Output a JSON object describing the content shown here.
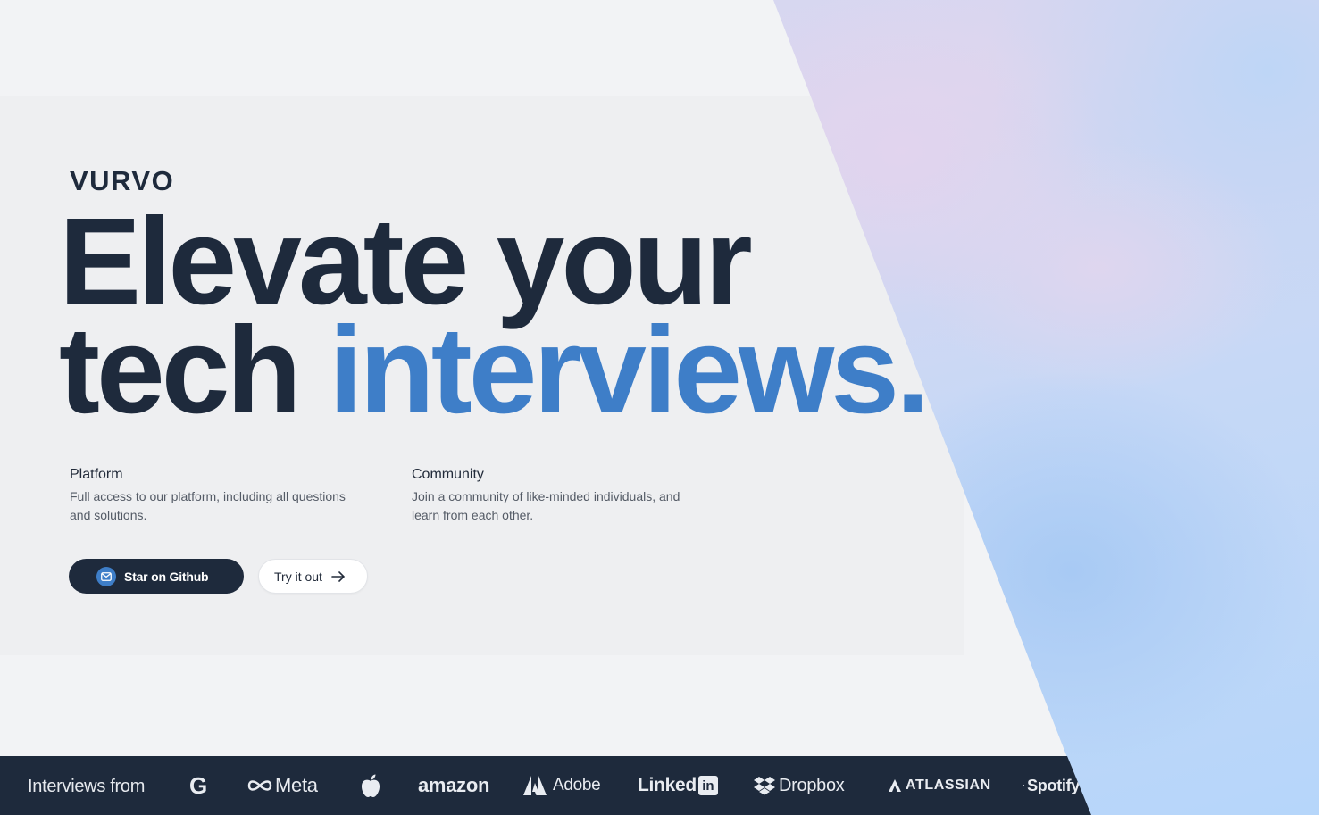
{
  "brand": "VURVO",
  "headline": {
    "line1": "Elevate your",
    "line2_plain": "tech ",
    "line2_accent": "interviews."
  },
  "features": {
    "platform": {
      "title": "Platform",
      "text_line1": "Full access to our platform, including all questions",
      "text_line2": "and solutions."
    },
    "community": {
      "title": "Community",
      "text_line1": "Join a community of like-minded individuals, and",
      "text_line2": "learn from each other."
    }
  },
  "actions": {
    "primary_label": "Star on Github",
    "secondary_label": "Try it out"
  },
  "logo_bar": {
    "label": "Interviews from",
    "logos": {
      "google": "G",
      "meta": "Meta",
      "amazon": "amazon",
      "adobe": "Adobe",
      "linkedin_text": "Linked",
      "linkedin_badge": "in",
      "dropbox": "Dropbox",
      "atlassian": "ATLASSIAN",
      "spotify": "Spotify"
    }
  },
  "colors": {
    "navy": "#1e2a3c",
    "accent_blue": "#3e7ec8",
    "page_bg": "#f2f3f5"
  },
  "icons": {
    "primary_button": "mail-icon",
    "secondary_button": "arrow-right-icon"
  }
}
